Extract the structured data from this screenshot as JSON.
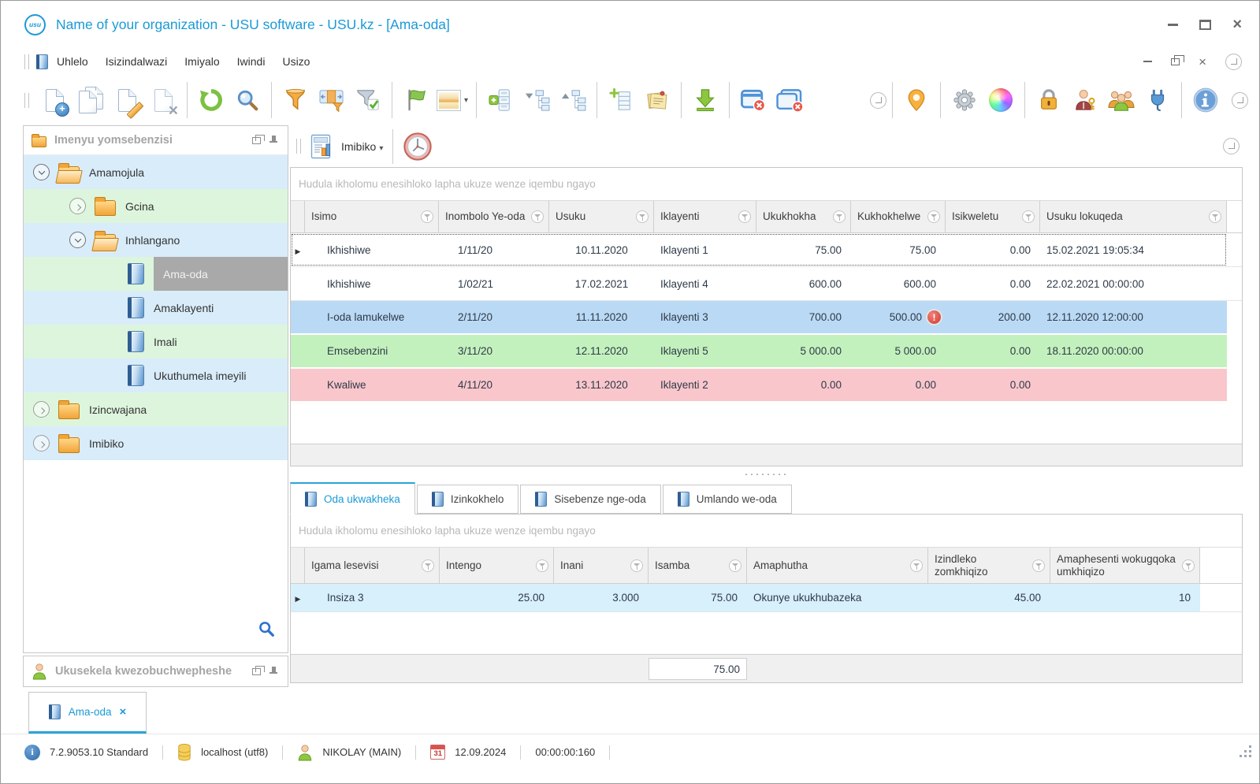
{
  "window": {
    "title": "Name of your organization - USU software - USU.kz - [Ama-oda]",
    "logo_text": "usu"
  },
  "menubar": {
    "items": [
      "Uhlelo",
      "Isizindalwazi",
      "Imiyalo",
      "Iwindi",
      "Usizo"
    ]
  },
  "toolbar": {
    "icon_names": [
      "new-document",
      "copy-document",
      "edit-document",
      "delete-document",
      "refresh",
      "search",
      "filter",
      "filter-columns",
      "filter-apply",
      "flag",
      "image",
      "group-rows",
      "expand-tree",
      "collapse-tree",
      "add-row",
      "notes",
      "export",
      "close-window",
      "close-all-windows",
      "more-commands",
      "location-pin",
      "settings-gear",
      "color-wheel",
      "lock",
      "user-permissions",
      "user-groups",
      "plugin",
      "info",
      "more-commands-right"
    ]
  },
  "sidebar": {
    "title": "Imenyu yomsebenzisi",
    "items": [
      {
        "label": "Amamojula"
      },
      {
        "label": "Gcina"
      },
      {
        "label": "Inhlangano"
      },
      {
        "label": "Ama-oda"
      },
      {
        "label": "Amaklayenti"
      },
      {
        "label": "Imali"
      },
      {
        "label": "Ukuthumela imeyili"
      },
      {
        "label": "Izincwajana"
      },
      {
        "label": "Imibiko"
      }
    ]
  },
  "support_panel": {
    "title": "Ukusekela kwezobuchwepheshe"
  },
  "report_bar": {
    "button_label": "Imibiko"
  },
  "orders": {
    "group_hint": "Hudula ikholomu enesihloko lapha ukuze wenze iqembu ngayo",
    "columns": [
      "Isimo",
      "Inombolo Ye-oda",
      "Usuku",
      "Iklayenti",
      "Ukukhokha",
      "Kukhokhelwe",
      "Isikweletu",
      "Usuku lokuqeda"
    ],
    "rows": [
      {
        "cells": [
          "Ikhishiwe",
          "1/11/20",
          "10.11.2020",
          "Iklayenti 1",
          "75.00",
          "75.00",
          "0.00",
          "15.02.2021 19:05:34"
        ]
      },
      {
        "cells": [
          "Ikhishiwe",
          "1/02/21",
          "17.02.2021",
          "Iklayenti 4",
          "600.00",
          "600.00",
          "0.00",
          "22.02.2021 00:00:00"
        ]
      },
      {
        "cells": [
          "I-oda lamukelwe",
          "2/11/20",
          "11.11.2020",
          "Iklayenti 3",
          "700.00",
          "500.00",
          "200.00",
          "12.11.2020 12:00:00"
        ]
      },
      {
        "cells": [
          "Emsebenzini",
          "3/11/20",
          "12.11.2020",
          "Iklayenti 5",
          "5 000.00",
          "5 000.00",
          "0.00",
          "18.11.2020 00:00:00"
        ]
      },
      {
        "cells": [
          "Kwaliwe",
          "4/11/20",
          "13.11.2020",
          "Iklayenti 2",
          "0.00",
          "0.00",
          "0.00",
          ""
        ]
      }
    ]
  },
  "detail_tabs": [
    {
      "label": "Oda ukwakheka"
    },
    {
      "label": "Izinkokhelo"
    },
    {
      "label": "Sisebenze nge-oda"
    },
    {
      "label": "Umlando we-oda"
    }
  ],
  "services": {
    "group_hint": "Hudula ikholomu enesihloko lapha ukuze wenze iqembu ngayo",
    "columns": [
      "Igama lesevisi",
      "Intengo",
      "Inani",
      "Isamba",
      "Amaphutha",
      "Izindleko zomkhiqizo",
      "Amaphesenti wokugqoka umkhiqizo"
    ],
    "rows": [
      {
        "cells": [
          "Insiza 3",
          "25.00",
          "3.000",
          "75.00",
          "Okunye ukukhubazeka",
          "45.00",
          "10"
        ]
      }
    ],
    "footer_total": "75.00"
  },
  "document_tabs": [
    {
      "label": "Ama-oda"
    }
  ],
  "statusbar": {
    "version": "7.2.9053.10 Standard",
    "database": "localhost (utf8)",
    "user": "NIKOLAY (MAIN)",
    "calendar_day": "31",
    "date": "12.09.2024",
    "timer": "00:00:00:160"
  },
  "colors": {
    "accent_blue": "#1b9ad6",
    "row_blue": "#bad9f5",
    "row_green": "#c3f1bd",
    "row_pink": "#f9c6cc",
    "detail_row_blue": "#d8effc",
    "tree_row_blue": "#d9ecfa",
    "tree_row_green": "#ddf5dd",
    "tree_selected_bg": "#a9a9a9"
  }
}
